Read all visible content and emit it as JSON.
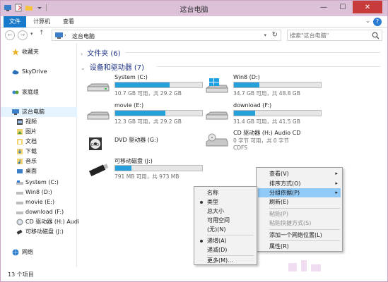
{
  "window": {
    "title": "这台电脑"
  },
  "ribbon": {
    "tabs": [
      "文件",
      "计算机",
      "查看"
    ]
  },
  "address": {
    "path": "这台电脑",
    "refresh_icon": "refresh-icon"
  },
  "search": {
    "placeholder": "搜索\"这台电脑\""
  },
  "sidebar": {
    "items": [
      {
        "label": "收藏夹",
        "icon": "star-icon"
      },
      {
        "label": "SkyDrive",
        "icon": "cloud-icon"
      },
      {
        "label": "家庭组",
        "icon": "homegroup-icon"
      },
      {
        "label": "这台电脑",
        "icon": "computer-icon"
      },
      {
        "label": "视频",
        "icon": "video-folder-icon"
      },
      {
        "label": "图片",
        "icon": "pictures-folder-icon"
      },
      {
        "label": "文档",
        "icon": "documents-folder-icon"
      },
      {
        "label": "下载",
        "icon": "downloads-folder-icon"
      },
      {
        "label": "音乐",
        "icon": "music-folder-icon"
      },
      {
        "label": "桌面",
        "icon": "desktop-folder-icon"
      },
      {
        "label": "System (C:)",
        "icon": "drive-icon"
      },
      {
        "label": "Win8 (D:)",
        "icon": "drive-icon"
      },
      {
        "label": "movie (E:)",
        "icon": "drive-icon"
      },
      {
        "label": "download (F:)",
        "icon": "drive-icon"
      },
      {
        "label": "CD 驱动器 (H:) Audi",
        "icon": "cd-icon"
      },
      {
        "label": "可移动磁盘 (J:)",
        "icon": "usb-icon"
      },
      {
        "label": "网络",
        "icon": "network-icon"
      }
    ]
  },
  "main": {
    "folders_header": "文件夹 (6)",
    "devices_header": "设备和驱动器 (7)",
    "drives": [
      {
        "name": "System (C:)",
        "info": "10.7 GB 可用，共 29.2 GB",
        "used": 0.63
      },
      {
        "name": "Win8 (D:)",
        "info": "34.7 GB 可用，共 48.8 GB",
        "used": 0.29
      },
      {
        "name": "movie (E:)",
        "info": "12.3 GB 可用，共 29.2 GB",
        "used": 0.58
      },
      {
        "name": "download (F:)",
        "info": "31.4 GB 可用，共 41.5 GB",
        "used": 0.24
      },
      {
        "name": "DVD 驱动器 (G:)"
      },
      {
        "name": "CD 驱动器 (H:) Audio CD",
        "info": "0 字节 可用，共 0 字节",
        "fs": "CDFS"
      },
      {
        "name": "可移动磁盘 (J:)",
        "info": "791 MB 可用，共 973 MB",
        "used": 0.19
      }
    ]
  },
  "status": {
    "count": "13 个项目"
  },
  "context_menu_main": {
    "items": [
      "查看(V)",
      "排序方式(O)",
      "分组依据(P)",
      "刷新(E)",
      "粘贴(P)",
      "粘贴快捷方式(S)",
      "添加一个网络位置(L)",
      "属性(R)"
    ]
  },
  "context_menu_sub": {
    "items": [
      "名称",
      "类型",
      "总大小",
      "可用空间",
      "(无)(N)",
      "递增(A)",
      "递减(D)",
      "更多(M)..."
    ]
  },
  "colors": {
    "accent": "#1979ca",
    "titlebar": "#dcc1d9",
    "bar_fill": "#26a0da",
    "highlight": "#91c9f7"
  }
}
